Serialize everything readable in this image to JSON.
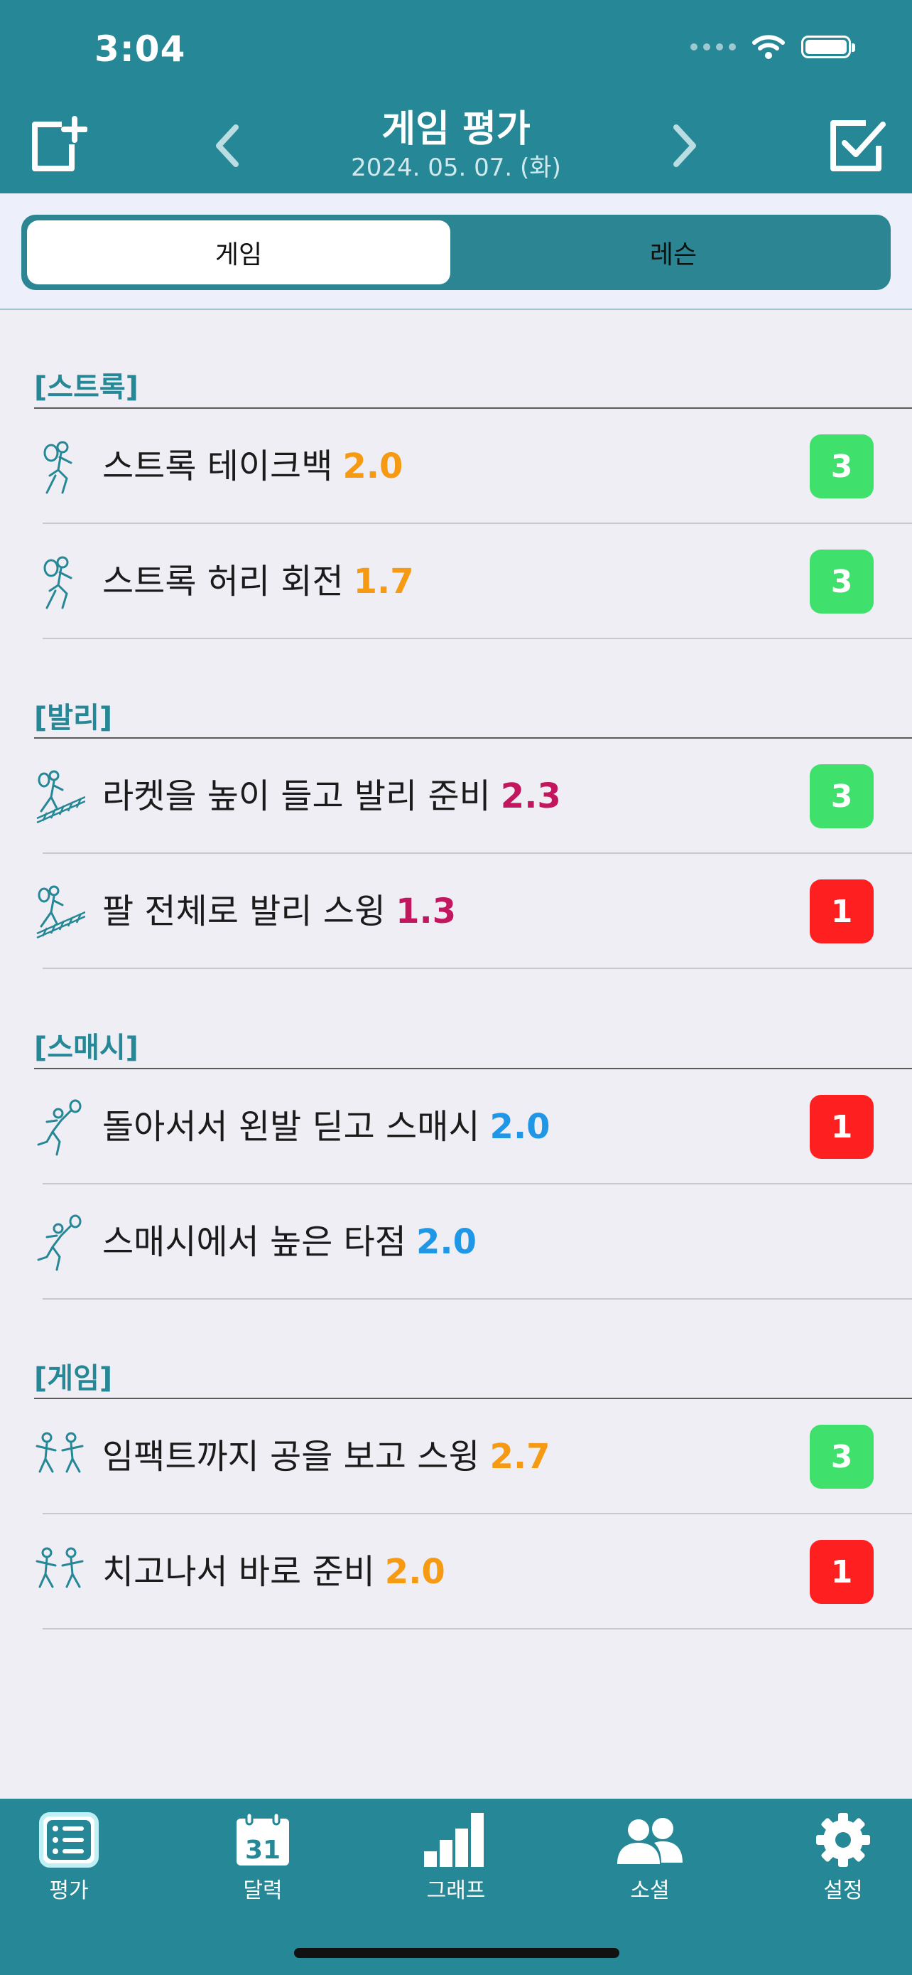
{
  "status": {
    "time": "3:04"
  },
  "header": {
    "title": "게임 평가",
    "date": "2024. 05. 07. (화)"
  },
  "segments": {
    "active": "게임",
    "inactive": "레슨"
  },
  "colors": {
    "teal": "#268896",
    "orange": "#f59a12",
    "magenta": "#c2165e",
    "blue": "#1f97e6",
    "green": "#3fe06b",
    "red": "#fe2020"
  },
  "sections": [
    {
      "title": "[스트록]",
      "items": [
        {
          "label": "스트록 테이크백",
          "score": "2.0",
          "badge": "3",
          "icon": "stroke-player-icon"
        },
        {
          "label": "스트록 허리 회전",
          "score": "1.7",
          "badge": "3",
          "icon": "stroke-player-icon"
        }
      ]
    },
    {
      "title": "[발리]",
      "items": [
        {
          "label": "라켓을 높이 들고 발리 준비",
          "score": "2.3",
          "badge": "3",
          "icon": "volley-net-icon"
        },
        {
          "label": "팔 전체로 발리 스윙",
          "score": "1.3",
          "badge": "1",
          "icon": "volley-net-icon"
        }
      ]
    },
    {
      "title": "[스매시]",
      "items": [
        {
          "label": "돌아서서 왼발 딛고 스매시",
          "score": "2.0",
          "badge": "1",
          "icon": "smash-player-icon"
        },
        {
          "label": "스매시에서 높은 타점",
          "score": "2.0",
          "badge": "",
          "icon": "smash-player-icon"
        }
      ]
    },
    {
      "title": "[게임]",
      "items": [
        {
          "label": "임팩트까지 공을 보고 스윙",
          "score": "2.7",
          "badge": "3",
          "icon": "doubles-players-icon"
        },
        {
          "label": "치고나서 바로 준비",
          "score": "2.0",
          "badge": "1",
          "icon": "doubles-players-icon"
        }
      ]
    }
  ],
  "tabs": [
    {
      "label": "평가",
      "icon": "list-icon"
    },
    {
      "label": "달력",
      "icon": "calendar-icon",
      "calendar_day": "31"
    },
    {
      "label": "그래프",
      "icon": "bar-chart-icon"
    },
    {
      "label": "소셜",
      "icon": "people-icon"
    },
    {
      "label": "설정",
      "icon": "gear-icon"
    }
  ]
}
